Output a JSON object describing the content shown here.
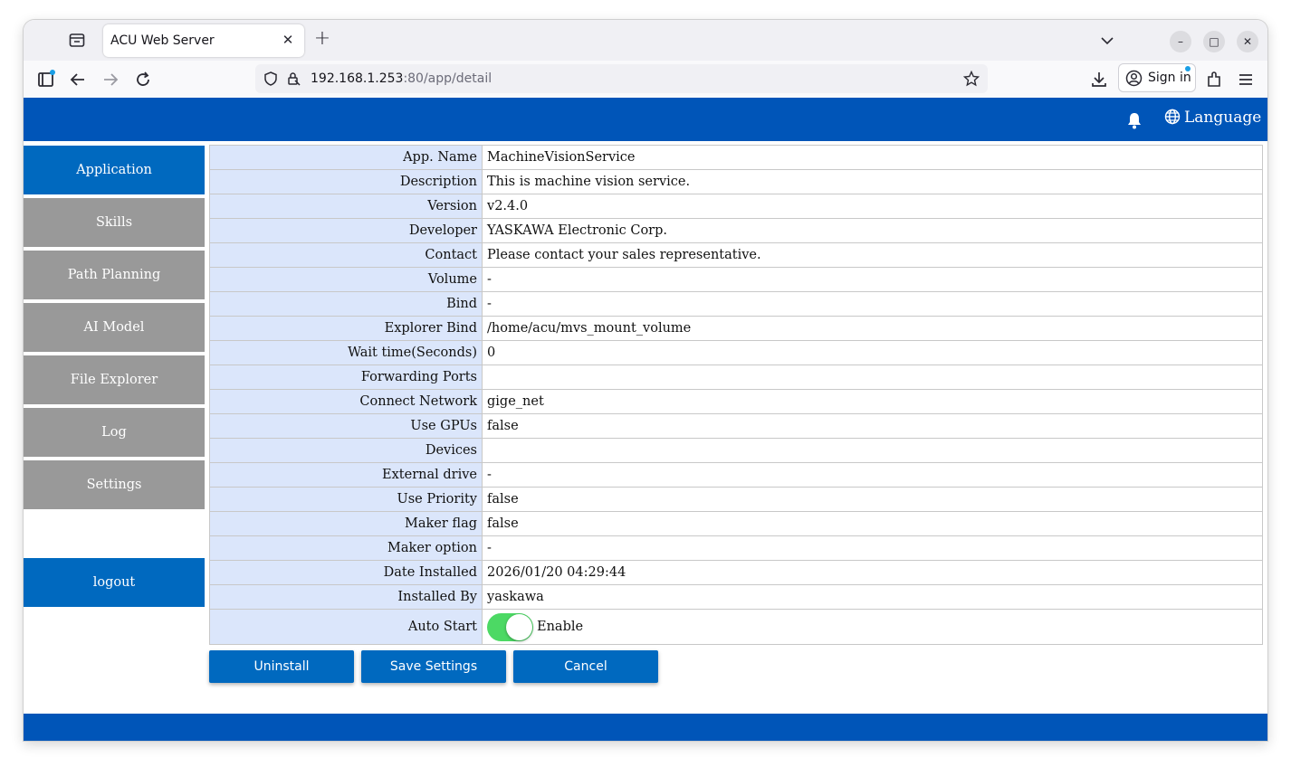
{
  "browser": {
    "tab_title": "ACU Web Server",
    "tab_close": "✕",
    "new_tab": "+",
    "url_host": "192.168.1.253",
    "url_rest": ":80/app/detail",
    "sign_in": "Sign in",
    "minimize": "–",
    "maximize": "□",
    "close": "✕"
  },
  "header": {
    "language": "Language"
  },
  "sidebar": {
    "items": [
      {
        "label": "Application",
        "active": true
      },
      {
        "label": "Skills",
        "active": false
      },
      {
        "label": "Path Planning",
        "active": false
      },
      {
        "label": "AI Model",
        "active": false
      },
      {
        "label": "File Explorer",
        "active": false
      },
      {
        "label": "Log",
        "active": false
      },
      {
        "label": "Settings",
        "active": false
      }
    ],
    "logout": "logout"
  },
  "details": {
    "rows": [
      {
        "label": "App. Name",
        "value": "MachineVisionService"
      },
      {
        "label": "Description",
        "value": "This is machine vision service."
      },
      {
        "label": "Version",
        "value": "v2.4.0"
      },
      {
        "label": "Developer",
        "value": "YASKAWA Electronic Corp."
      },
      {
        "label": "Contact",
        "value": "Please contact your sales representative."
      },
      {
        "label": "Volume",
        "value": "-"
      },
      {
        "label": "Bind",
        "value": "-"
      },
      {
        "label": "Explorer Bind",
        "value": "/home/acu/mvs_mount_volume"
      },
      {
        "label": "Wait time(Seconds)",
        "value": "0"
      },
      {
        "label": "Forwarding Ports",
        "value": ""
      },
      {
        "label": "Connect Network",
        "value": "gige_net"
      },
      {
        "label": "Use GPUs",
        "value": "false"
      },
      {
        "label": "Devices",
        "value": ""
      },
      {
        "label": "External drive",
        "value": "-"
      },
      {
        "label": "Use Priority",
        "value": "false"
      },
      {
        "label": "Maker flag",
        "value": "false"
      },
      {
        "label": "Maker option",
        "value": "-"
      },
      {
        "label": "Date Installed",
        "value": "2026/01/20 04:29:44"
      },
      {
        "label": "Installed By",
        "value": "yaskawa"
      }
    ],
    "auto_start": {
      "label": "Auto Start",
      "toggle_label": "Enable",
      "enabled": true
    }
  },
  "actions": {
    "uninstall": "Uninstall",
    "save": "Save Settings",
    "cancel": "Cancel"
  },
  "colors": {
    "header_blue": "#0055b8",
    "button_blue": "#0069bf",
    "sidebar_gray": "#999999",
    "label_bg": "#dbe6fb",
    "toggle_green": "#4cd964"
  }
}
